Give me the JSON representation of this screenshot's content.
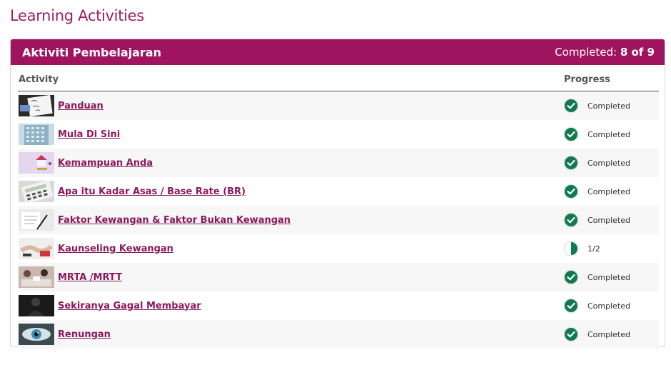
{
  "page": {
    "title": "Learning Activities"
  },
  "panel": {
    "title": "Aktiviti Pembelajaran",
    "completed_label": "Completed:",
    "completed_value": "8 of 9"
  },
  "table": {
    "col_activity": "Activity",
    "col_progress": "Progress",
    "rows": [
      {
        "title": "Panduan",
        "status": "Completed",
        "icon": "check-circle-icon",
        "thumb": "handwriting-note-thumbnail"
      },
      {
        "title": "Mula Di Sini",
        "status": "Completed",
        "icon": "check-circle-icon",
        "thumb": "building-thumbnail"
      },
      {
        "title": "Kemampuan Anda",
        "status": "Completed",
        "icon": "check-circle-icon",
        "thumb": "house-coins-thumbnail"
      },
      {
        "title": "Apa itu Kadar Asas / Base Rate (BR)",
        "status": "Completed",
        "icon": "check-circle-icon",
        "thumb": "calculator-thumbnail"
      },
      {
        "title": "Faktor Kewangan & Faktor Bukan Kewangan",
        "status": "Completed",
        "icon": "check-circle-icon",
        "thumb": "pen-paper-thumbnail"
      },
      {
        "title": "Kaunseling Kewangan",
        "status": "1/2",
        "icon": "half-circle-icon",
        "thumb": "handshake-thumbnail"
      },
      {
        "title": "MRTA /MRTT",
        "status": "Completed",
        "icon": "check-circle-icon",
        "thumb": "meeting-thumbnail"
      },
      {
        "title": "Sekiranya Gagal Membayar",
        "status": "Completed",
        "icon": "check-circle-icon",
        "thumb": "dark-figure-thumbnail"
      },
      {
        "title": "Renungan",
        "status": "Completed",
        "icon": "check-circle-icon",
        "thumb": "eye-thumbnail"
      }
    ]
  },
  "colors": {
    "brand": "#a0145f",
    "link": "#8a1a5c",
    "check": "#0f7a4e"
  }
}
